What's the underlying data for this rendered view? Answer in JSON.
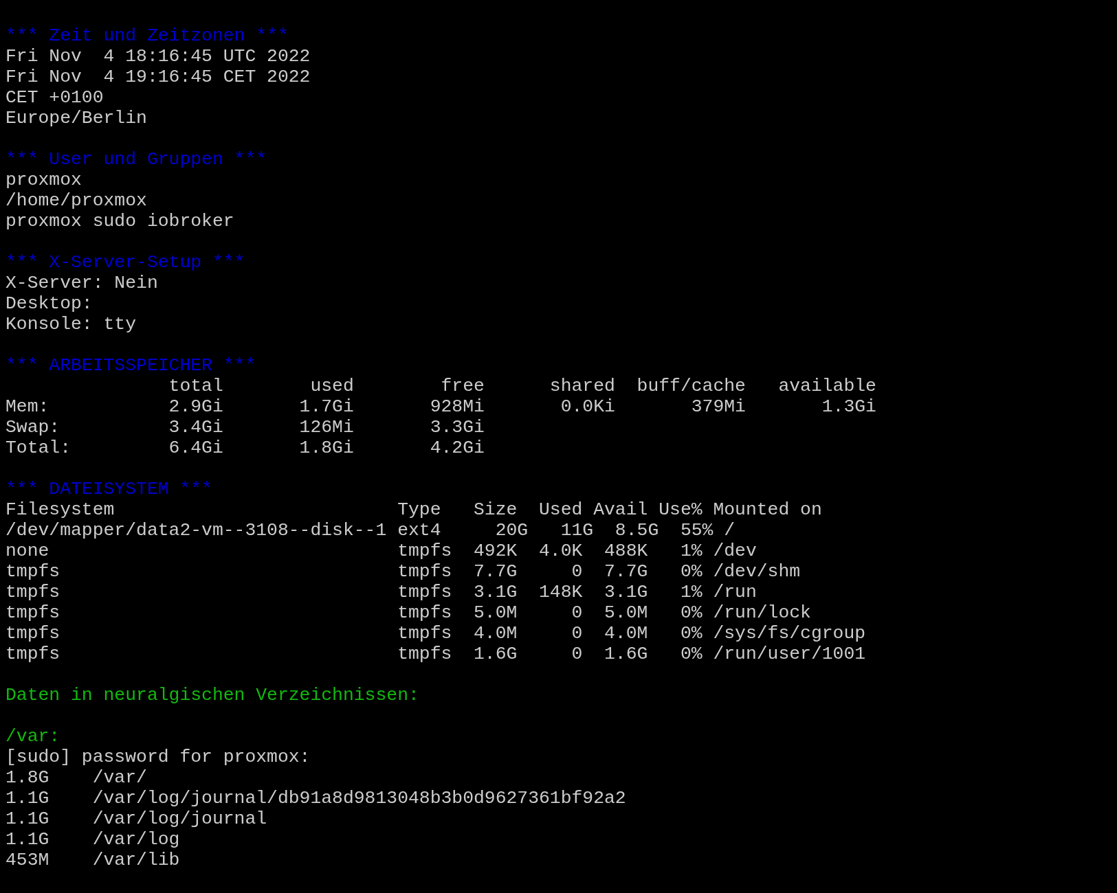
{
  "terminal": {
    "lines": [
      {
        "kind": "blank"
      },
      {
        "kind": "heading",
        "text": "*** Zeit und Zeitzonen ***"
      },
      {
        "kind": "output",
        "text": "Fri Nov  4 18:16:45 UTC 2022"
      },
      {
        "kind": "output",
        "text": "Fri Nov  4 19:16:45 CET 2022"
      },
      {
        "kind": "output",
        "text": "CET +0100"
      },
      {
        "kind": "output",
        "text": "Europe/Berlin"
      },
      {
        "kind": "blank"
      },
      {
        "kind": "heading",
        "text": "*** User und Gruppen ***"
      },
      {
        "kind": "output",
        "text": "proxmox"
      },
      {
        "kind": "output",
        "text": "/home/proxmox"
      },
      {
        "kind": "output",
        "text": "proxmox sudo iobroker"
      },
      {
        "kind": "blank"
      },
      {
        "kind": "heading",
        "text": "*** X-Server-Setup ***"
      },
      {
        "kind": "output",
        "text": "X-Server: Nein"
      },
      {
        "kind": "output",
        "text": "Desktop:"
      },
      {
        "kind": "output",
        "text": "Konsole: tty"
      },
      {
        "kind": "blank"
      },
      {
        "kind": "heading",
        "text": "*** ARBEITSSPEICHER ***"
      },
      {
        "kind": "output",
        "text": "               total        used        free      shared  buff/cache   available"
      },
      {
        "kind": "output",
        "text": "Mem:           2.9Gi       1.7Gi       928Mi       0.0Ki       379Mi       1.3Gi"
      },
      {
        "kind": "output",
        "text": "Swap:          3.4Gi       126Mi       3.3Gi"
      },
      {
        "kind": "output",
        "text": "Total:         6.4Gi       1.8Gi       4.2Gi"
      },
      {
        "kind": "blank"
      },
      {
        "kind": "heading",
        "text": "*** DATEISYSTEM ***"
      },
      {
        "kind": "output",
        "text": "Filesystem                          Type   Size  Used Avail Use% Mounted on"
      },
      {
        "kind": "output",
        "text": "/dev/mapper/data2-vm--3108--disk--1 ext4     20G   11G  8.5G  55% /"
      },
      {
        "kind": "output",
        "text": "none                                tmpfs  492K  4.0K  488K   1% /dev"
      },
      {
        "kind": "output",
        "text": "tmpfs                               tmpfs  7.7G     0  7.7G   0% /dev/shm"
      },
      {
        "kind": "output",
        "text": "tmpfs                               tmpfs  3.1G  148K  3.1G   1% /run"
      },
      {
        "kind": "output",
        "text": "tmpfs                               tmpfs  5.0M     0  5.0M   0% /run/lock"
      },
      {
        "kind": "output",
        "text": "tmpfs                               tmpfs  4.0M     0  4.0M   0% /sys/fs/cgroup"
      },
      {
        "kind": "output",
        "text": "tmpfs                               tmpfs  1.6G     0  1.6G   0% /run/user/1001"
      },
      {
        "kind": "blank"
      },
      {
        "kind": "note",
        "text": "Daten in neuralgischen Verzeichnissen:"
      },
      {
        "kind": "blank"
      },
      {
        "kind": "note",
        "text": "/var:"
      },
      {
        "kind": "output",
        "text": "[sudo] password for proxmox:"
      },
      {
        "kind": "output",
        "text": "1.8G    /var/"
      },
      {
        "kind": "output",
        "text": "1.1G    /var/log/journal/db91a8d9813048b3b0d9627361bf92a2"
      },
      {
        "kind": "output",
        "text": "1.1G    /var/log/journal"
      },
      {
        "kind": "output",
        "text": "1.1G    /var/log"
      },
      {
        "kind": "output",
        "text": "453M    /var/lib"
      }
    ]
  }
}
